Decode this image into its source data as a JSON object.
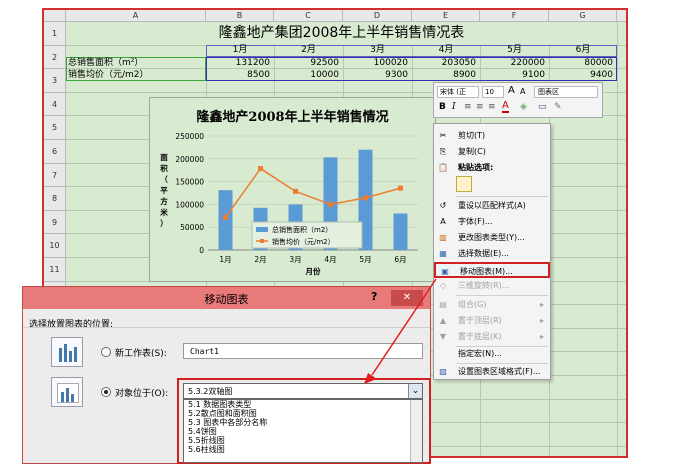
{
  "spreadsheet": {
    "columns": [
      "A",
      "B",
      "C",
      "D",
      "E",
      "F",
      "G",
      "H"
    ],
    "rows": [
      "1",
      "2",
      "3",
      "4",
      "5",
      "6",
      "7",
      "8",
      "9",
      "10",
      "11",
      "12",
      "13",
      "14",
      "15",
      "16",
      "17",
      "18",
      "19"
    ],
    "title": "隆鑫地产集团2008年上半年销售情况表",
    "months": [
      "1月",
      "2月",
      "3月",
      "4月",
      "5月",
      "6月"
    ],
    "row_area_label": "总销售面积（m²）",
    "row_price_label": "销售均价（元/m2）",
    "area_values": [
      "131200",
      "92500",
      "100020",
      "203050",
      "220000",
      "80000"
    ],
    "price_values": [
      "8500",
      "10000",
      "9300",
      "8900",
      "9100",
      "9400"
    ]
  },
  "chart_data": {
    "type": "bar",
    "title": "隆鑫地产2008年上半年销售情况",
    "categories": [
      "1月",
      "2月",
      "3月",
      "4月",
      "5月",
      "6月"
    ],
    "series": [
      {
        "name": "总销售面积（m2）",
        "type": "bar",
        "axis": "left",
        "values": [
          131200,
          92500,
          100020,
          203050,
          220000,
          80000
        ]
      },
      {
        "name": "销售均价（元/m2）",
        "type": "line",
        "axis": "right",
        "values": [
          8500,
          10000,
          9300,
          8900,
          9100,
          9400
        ]
      }
    ],
    "ylabel": "面积（平方米）",
    "xlabel": "月份",
    "ylim": [
      0,
      250000
    ],
    "yticks": [
      "0",
      "50000",
      "100000",
      "150000",
      "200000",
      "250000"
    ],
    "legend_position": "bottom-center",
    "colors": {
      "bar": "#5b9bd5",
      "line": "#ed7d31"
    }
  },
  "mini_toolbar": {
    "font_name": "宋体 (正",
    "font_size": "10",
    "grow_font": "A",
    "shrink_font": "A",
    "chart_area_selector": "图表区",
    "bold": "B",
    "italic": "I",
    "font_color_letter": "A"
  },
  "context_menu": {
    "items": [
      {
        "label": "剪切(T)",
        "icon": "✂",
        "disabled": false
      },
      {
        "label": "复制(C)",
        "icon": "⎘",
        "disabled": false
      },
      {
        "label": "粘贴选项:",
        "icon": "📋",
        "disabled": false
      },
      {
        "label": "重设以匹配样式(A)",
        "icon": "↺",
        "disabled": false
      },
      {
        "label": "字体(F)...",
        "icon": "A",
        "disabled": false
      },
      {
        "label": "更改图表类型(Y)...",
        "icon": "▥",
        "disabled": false
      },
      {
        "label": "选择数据(E)...",
        "icon": "▦",
        "disabled": false
      },
      {
        "label": "移动图表(M)...",
        "icon": "▣",
        "disabled": false
      },
      {
        "label": "三维旋转(R)...",
        "icon": "◇",
        "disabled": true
      },
      {
        "label": "组合(G)",
        "icon": "▤",
        "disabled": true
      },
      {
        "label": "置于顶层(R)",
        "icon": "▲",
        "disabled": true
      },
      {
        "label": "置于底层(K)",
        "icon": "▼",
        "disabled": true
      },
      {
        "label": "指定宏(N)...",
        "icon": "",
        "disabled": false
      },
      {
        "label": "设置图表区域格式(F)...",
        "icon": "▨",
        "disabled": false
      }
    ]
  },
  "dialog": {
    "title": "移动图表",
    "help": "?",
    "close": "✕",
    "prompt": "选择放置图表的位置:",
    "new_sheet_label": "新工作表(S):",
    "new_sheet_value": "Chart1",
    "object_in_label": "对象位于(O):",
    "selected_sheet": "5.3.2双轴图",
    "sheet_options": [
      "5.1 数据图表类型",
      "5.2散点图和面积图",
      "5.3 图表中各部分名称",
      "5.4饼图",
      "5.5折线图",
      "5.6柱线图"
    ]
  }
}
